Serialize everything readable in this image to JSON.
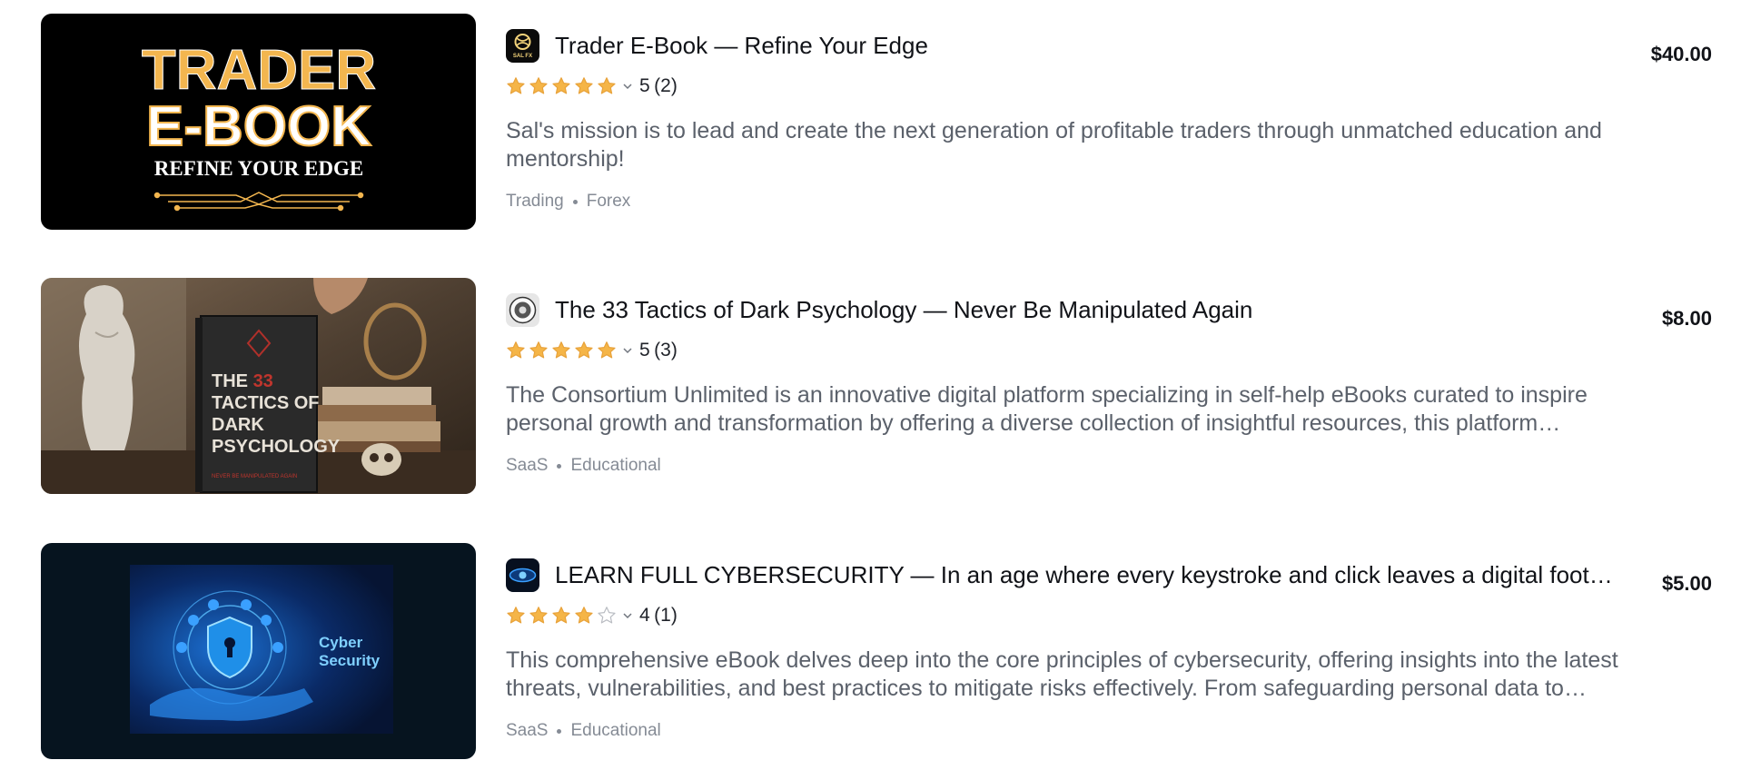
{
  "products": [
    {
      "title": "Trader E-Book — Refine Your Edge",
      "rating": "5",
      "rating_count": "(2)",
      "stars_filled": 5,
      "description": "Sal's mission is to lead and create the next generation of profitable traders through unmatched education and mentorship!",
      "tag1": "Trading",
      "tag2": "Forex",
      "price": "$40.00",
      "thumb": {
        "line1": "TRADER",
        "line2": "E-BOOK",
        "line3": "REFINE YOUR EDGE"
      },
      "avatar_text": "SAL FX"
    },
    {
      "title": "The 33 Tactics of Dark Psychology — Never Be Manipulated Again",
      "rating": "5",
      "rating_count": "(3)",
      "stars_filled": 5,
      "description": "The Consortium Unlimited is an innovative digital platform specializing in self-help eBooks curated to inspire personal growth and transformation by offering a diverse collection of insightful resources, this platform empowers individuals on their journey of self-improvement.",
      "tag1": "SaaS",
      "tag2": "Educational",
      "price": "$8.00",
      "thumb": {
        "line1": "THE",
        "num": "33",
        "line2": "TACTICS OF",
        "line3": "DARK",
        "line4": "PSYCHOLOGY",
        "line5": "NEVER BE MANIPULATED AGAIN"
      }
    },
    {
      "title": "LEARN FULL CYBERSECURITY — In an age where every keystroke and click leaves a digital footprint",
      "rating": "4",
      "rating_count": "(1)",
      "stars_filled": 4,
      "description": "This comprehensive eBook delves deep into the core principles of cybersecurity, offering insights into the latest threats, vulnerabilities, and best practices to mitigate risks effectively. From safeguarding personal data to protecting networks.",
      "tag1": "SaaS",
      "tag2": "Educational",
      "price": "$5.00",
      "thumb": {
        "line1": "Cyber",
        "line2": "Security"
      }
    }
  ],
  "colors": {
    "star_fill": "#f5b547",
    "star_empty": "#c9ccd1",
    "title": "#111318",
    "description": "#5b616b",
    "tags": "#858b95",
    "gold": "#f3b64f"
  }
}
